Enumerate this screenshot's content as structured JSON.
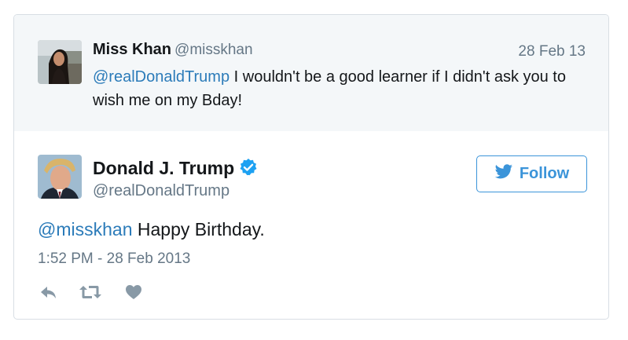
{
  "parent_tweet": {
    "author_name": "Miss Khan",
    "author_handle": "@misskhan",
    "date": "28 Feb 13",
    "mention": "@realDonaldTrump",
    "text": " I wouldn't be a good learner if I didn't ask you to wish me on my Bday!"
  },
  "main_tweet": {
    "author_name": "Donald J. Trump",
    "author_handle": "@realDonaldTrump",
    "verified_icon": "verified-badge-icon",
    "follow_label": "Follow",
    "mention": "@misskhan",
    "text": " Happy Birthday.",
    "timestamp": "1:52 PM - 28 Feb 2013"
  },
  "actions": {
    "reply_icon": "reply-icon",
    "retweet_icon": "retweet-icon",
    "like_icon": "heart-icon"
  },
  "colors": {
    "link": "#2b7bb9",
    "follow": "#3b94d9",
    "muted": "#657786",
    "verified": "#1da1f2",
    "parent_bg": "#f4f7f9"
  }
}
